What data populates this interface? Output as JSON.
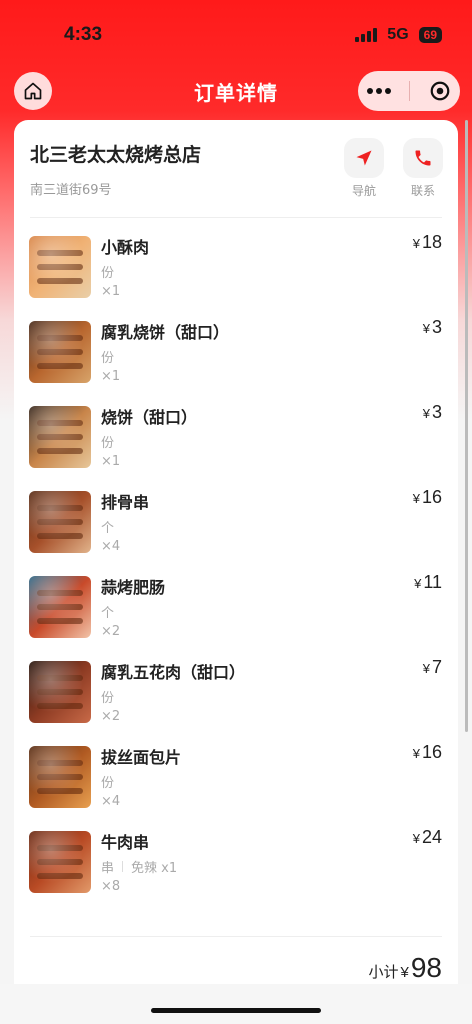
{
  "status": {
    "time": "4:33",
    "network": "5G",
    "battery": "69"
  },
  "nav": {
    "title": "订单详情"
  },
  "store": {
    "name": "北三老太太烧烤总店",
    "address": "南三道街69号",
    "navigate_label": "导航",
    "contact_label": "联系"
  },
  "items": [
    {
      "name": "小酥肉",
      "spec": "份",
      "note": "",
      "qty": "×1",
      "currency": "¥",
      "price": "18",
      "colors": [
        "#d9874a",
        "#f0b275",
        "#e9cfa8"
      ]
    },
    {
      "name": "腐乳烧饼（甜口）",
      "spec": "份",
      "note": "",
      "qty": "×1",
      "currency": "¥",
      "price": "3",
      "colors": [
        "#4a2c1c",
        "#b8662e",
        "#d8a46a"
      ]
    },
    {
      "name": "烧饼（甜口）",
      "spec": "份",
      "note": "",
      "qty": "×1",
      "currency": "¥",
      "price": "3",
      "colors": [
        "#3a2a20",
        "#c8854a",
        "#e7c79a"
      ]
    },
    {
      "name": "排骨串",
      "spec": "个",
      "note": "",
      "qty": "×4",
      "currency": "¥",
      "price": "16",
      "colors": [
        "#5a2e18",
        "#a6502a",
        "#e2b48c"
      ]
    },
    {
      "name": "蒜烤肥肠",
      "spec": "个",
      "note": "",
      "qty": "×2",
      "currency": "¥",
      "price": "11",
      "colors": [
        "#2f6a8a",
        "#c84a2a",
        "#f2c4a8"
      ]
    },
    {
      "name": "腐乳五花肉（甜口）",
      "spec": "份",
      "note": "",
      "qty": "×2",
      "currency": "¥",
      "price": "7",
      "colors": [
        "#2a1810",
        "#8c3a22",
        "#c96a48"
      ]
    },
    {
      "name": "拔丝面包片",
      "spec": "份",
      "note": "",
      "qty": "×4",
      "currency": "¥",
      "price": "16",
      "colors": [
        "#5a3018",
        "#b05a22",
        "#e8a050"
      ]
    },
    {
      "name": "牛肉串",
      "spec": "串",
      "note": "免辣 x1",
      "qty": "×8",
      "currency": "¥",
      "price": "24",
      "colors": [
        "#6a2a14",
        "#b84a24",
        "#e29a6a"
      ]
    }
  ],
  "summary": {
    "label": "小计",
    "currency": "¥",
    "total": "98"
  },
  "colors": {
    "brand_red": "#ff2a2a",
    "text_primary": "#222222",
    "text_secondary": "#999999"
  },
  "icons": {
    "home": "home-icon",
    "more": "more-dots-icon",
    "close": "close-target-icon",
    "navigate": "navigation-arrow-icon",
    "phone": "phone-icon"
  }
}
